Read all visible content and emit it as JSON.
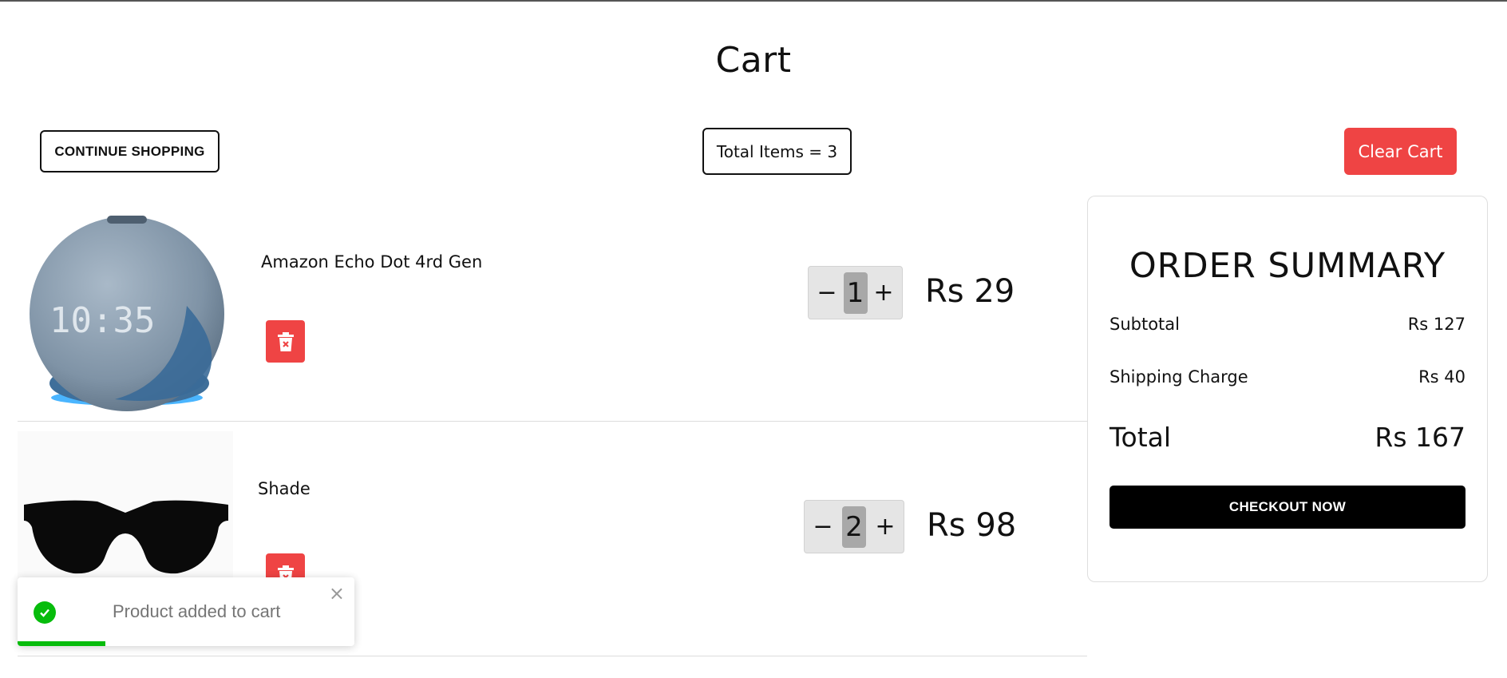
{
  "page": {
    "title": "Cart"
  },
  "toolbar": {
    "continue_label": "CONTINUE SHOPPING",
    "total_items_label": "Total Items = 3",
    "clear_label": "Clear Cart"
  },
  "cart": {
    "items": [
      {
        "name": "Amazon Echo Dot 4rd Gen",
        "quantity": "1",
        "price": "Rs 29",
        "image_icon": "echo-dot-image"
      },
      {
        "name": "Shade",
        "quantity": "2",
        "price": "Rs 98",
        "image_icon": "sunglasses-image"
      }
    ],
    "minus_symbol": "−",
    "plus_symbol": "+"
  },
  "summary": {
    "title": "ORDER SUMMARY",
    "subtotal_label": "Subtotal",
    "subtotal_value": "Rs 127",
    "shipping_label": "Shipping Charge",
    "shipping_value": "Rs 40",
    "total_label": "Total",
    "total_value": "Rs 167",
    "checkout_label": "CHECKOUT NOW"
  },
  "toast": {
    "message": "Product added to cart",
    "close_symbol": "×",
    "progress_fraction": 0.26
  },
  "colors": {
    "danger": "#ef4444",
    "success": "#07bc0c",
    "black": "#000000",
    "qty_bg": "#e5e5e5"
  }
}
